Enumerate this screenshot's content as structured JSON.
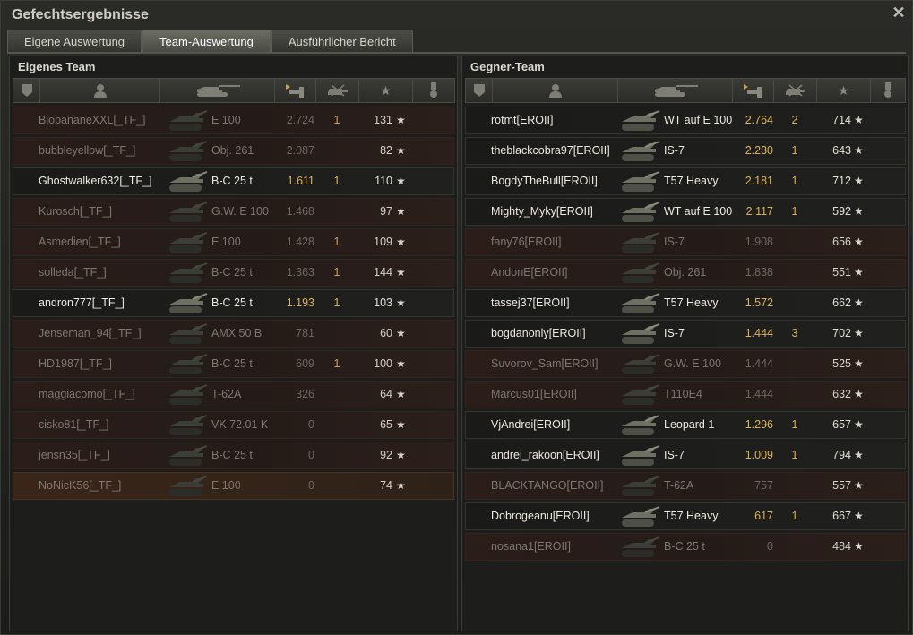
{
  "window": {
    "title": "Gefechtsergebnisse",
    "close_icon": "close-icon"
  },
  "tabs": [
    {
      "label": "Eigene Auswertung",
      "active": false
    },
    {
      "label": "Team-Auswertung",
      "active": true
    },
    {
      "label": "Ausführlicher Bericht",
      "active": false
    }
  ],
  "colors": {
    "damage": "#d9b35b",
    "player_row": "#3a2519",
    "dead_row": "#2a1d1a"
  },
  "own_team": {
    "title": "Eigenes Team",
    "rows": [
      {
        "name": "BiobananeXXL[_TF_]",
        "tank": "E 100",
        "damage": "2.724",
        "kills": "1",
        "xp": "131",
        "state": "dead"
      },
      {
        "name": "bubbleyellow[_TF_]",
        "tank": "Obj. 261",
        "damage": "2.087",
        "kills": "",
        "xp": "82",
        "state": "dead"
      },
      {
        "name": "Ghostwalker632[_TF_]",
        "tank": "B-C 25 t",
        "damage": "1.611",
        "kills": "1",
        "xp": "110",
        "state": "alive"
      },
      {
        "name": "Kurosch[_TF_]",
        "tank": "G.W. E 100",
        "damage": "1.468",
        "kills": "",
        "xp": "97",
        "state": "dead"
      },
      {
        "name": "Asmedien[_TF_]",
        "tank": "E 100",
        "damage": "1.428",
        "kills": "1",
        "xp": "109",
        "state": "dead"
      },
      {
        "name": "solleda[_TF_]",
        "tank": "B-C 25 t",
        "damage": "1.363",
        "kills": "1",
        "xp": "144",
        "state": "dead"
      },
      {
        "name": "andron777[_TF_]",
        "tank": "B-C 25 t",
        "damage": "1.193",
        "kills": "1",
        "xp": "103",
        "state": "alive"
      },
      {
        "name": "Jenseman_94[_TF_]",
        "tank": "AMX 50 B",
        "damage": "781",
        "kills": "",
        "xp": "60",
        "state": "dead"
      },
      {
        "name": "HD1987[_TF_]",
        "tank": "B-C 25 t",
        "damage": "609",
        "kills": "1",
        "xp": "100",
        "state": "dead"
      },
      {
        "name": "maggiacomo[_TF_]",
        "tank": "T-62A",
        "damage": "326",
        "kills": "",
        "xp": "64",
        "state": "dead"
      },
      {
        "name": "cisko81[_TF_]",
        "tank": "VK 72.01 K",
        "damage": "0",
        "kills": "",
        "xp": "65",
        "state": "dead"
      },
      {
        "name": "jensn35[_TF_]",
        "tank": "B-C 25 t",
        "damage": "0",
        "kills": "",
        "xp": "92",
        "state": "dead"
      },
      {
        "name": "NoNicK56[_TF_]",
        "tank": "E 100",
        "damage": "0",
        "kills": "",
        "xp": "74",
        "state": "player"
      }
    ]
  },
  "enemy_team": {
    "title": "Gegner-Team",
    "rows": [
      {
        "name": "rotmt[EROII]",
        "tank": "WT auf E 100",
        "damage": "2.764",
        "kills": "2",
        "xp": "714",
        "state": "alive"
      },
      {
        "name": "theblackcobra97[EROII]",
        "tank": "IS-7",
        "damage": "2.230",
        "kills": "1",
        "xp": "643",
        "state": "alive"
      },
      {
        "name": "BogdyTheBull[EROII]",
        "tank": "T57 Heavy",
        "damage": "2.181",
        "kills": "1",
        "xp": "712",
        "state": "alive"
      },
      {
        "name": "Mighty_Myky[EROII]",
        "tank": "WT auf E 100",
        "damage": "2.117",
        "kills": "1",
        "xp": "592",
        "state": "alive"
      },
      {
        "name": "fany76[EROII]",
        "tank": "IS-7",
        "damage": "1.908",
        "kills": "",
        "xp": "656",
        "state": "dead"
      },
      {
        "name": "AndonE[EROII]",
        "tank": "Obj. 261",
        "damage": "1.838",
        "kills": "",
        "xp": "551",
        "state": "dead"
      },
      {
        "name": "tassej37[EROII]",
        "tank": "T57 Heavy",
        "damage": "1.572",
        "kills": "",
        "xp": "662",
        "state": "alive"
      },
      {
        "name": "bogdanonly[EROII]",
        "tank": "IS-7",
        "damage": "1.444",
        "kills": "3",
        "xp": "702",
        "state": "alive"
      },
      {
        "name": "Suvorov_Sam[EROII]",
        "tank": "G.W. E 100",
        "damage": "1.444",
        "kills": "",
        "xp": "525",
        "state": "dead"
      },
      {
        "name": "Marcus01[EROII]",
        "tank": "T110E4",
        "damage": "1.444",
        "kills": "",
        "xp": "632",
        "state": "dead"
      },
      {
        "name": "VjAndrei[EROII]",
        "tank": "Leopard 1",
        "damage": "1.296",
        "kills": "1",
        "xp": "657",
        "state": "alive"
      },
      {
        "name": "andrei_rakoon[EROII]",
        "tank": "IS-7",
        "damage": "1.009",
        "kills": "1",
        "xp": "794",
        "state": "alive"
      },
      {
        "name": "BLACKTANGO[EROII]",
        "tank": "T-62A",
        "damage": "757",
        "kills": "",
        "xp": "557",
        "state": "dead"
      },
      {
        "name": "Dobrogeanu[EROII]",
        "tank": "T57 Heavy",
        "damage": "617",
        "kills": "1",
        "xp": "667",
        "state": "alive"
      },
      {
        "name": "nosana1[EROII]",
        "tank": "B-C 25 t",
        "damage": "0",
        "kills": "",
        "xp": "484",
        "state": "dead"
      }
    ]
  },
  "header_icons": [
    "squad-icon",
    "player-icon",
    "tank-icon",
    "damage-icon",
    "kills-icon",
    "xp-star-icon",
    "medal-icon"
  ]
}
